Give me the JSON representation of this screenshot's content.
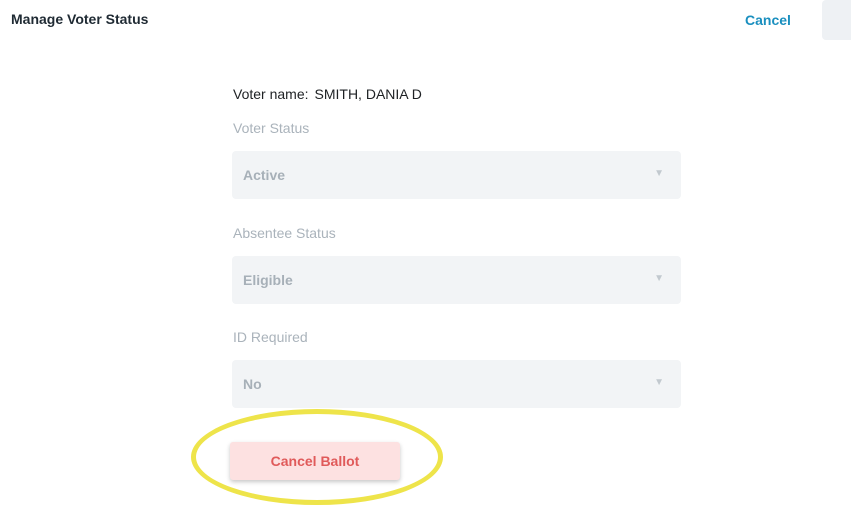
{
  "header": {
    "title": "Manage Voter Status",
    "cancel_label": "Cancel"
  },
  "voter": {
    "name_label": "Voter name:",
    "name_value": "SMITH, DANIA D"
  },
  "fields": {
    "voter_status": {
      "label": "Voter Status",
      "value": "Active"
    },
    "absentee_status": {
      "label": "Absentee Status",
      "value": "Eligible"
    },
    "id_required": {
      "label": "ID Required",
      "value": "No"
    }
  },
  "actions": {
    "cancel_ballot_label": "Cancel Ballot"
  },
  "colors": {
    "accent_link": "#1a8fbf",
    "danger_text": "#e05a5a",
    "danger_bg": "#fde1e1",
    "highlight": "#eee44a"
  }
}
